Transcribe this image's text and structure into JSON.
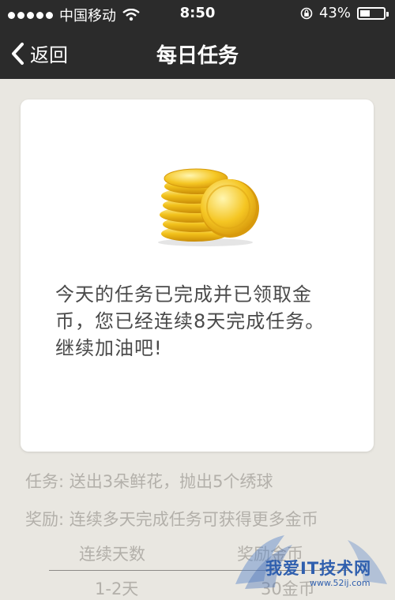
{
  "status_bar": {
    "carrier": "中国移动",
    "time": "8:50",
    "battery_percent": "43%",
    "battery_level": 0.43,
    "icons": [
      "signal-dots-icon",
      "wifi-icon",
      "rotation-lock-icon",
      "battery-icon"
    ]
  },
  "nav": {
    "back_label": "返回",
    "title": "每日任务",
    "back_icon": "chevron-left-icon"
  },
  "card": {
    "image": "gold-coins-stack",
    "message": "今天的任务已完成并已领取金币，您已经连续8天完成任务。继续加油吧!"
  },
  "info": {
    "task": "任务: 送出3朵鲜花，抛出5个绣球",
    "reward": "奖励: 连续多天完成任务可获得更多金币"
  },
  "table": {
    "headers": [
      "连续天数",
      "奖励金币"
    ],
    "rows": [
      [
        "1-2天",
        "30金币"
      ]
    ]
  },
  "watermark": {
    "text": "我爱IT技术网",
    "sub": "www.52ij.com"
  },
  "colors": {
    "bar_bg": "#2b2b2b",
    "page_bg": "#e9e7e1",
    "muted_text": "#b3b0aa",
    "message_text": "#4a4a4a",
    "coin_gold": "#f2c21b"
  }
}
